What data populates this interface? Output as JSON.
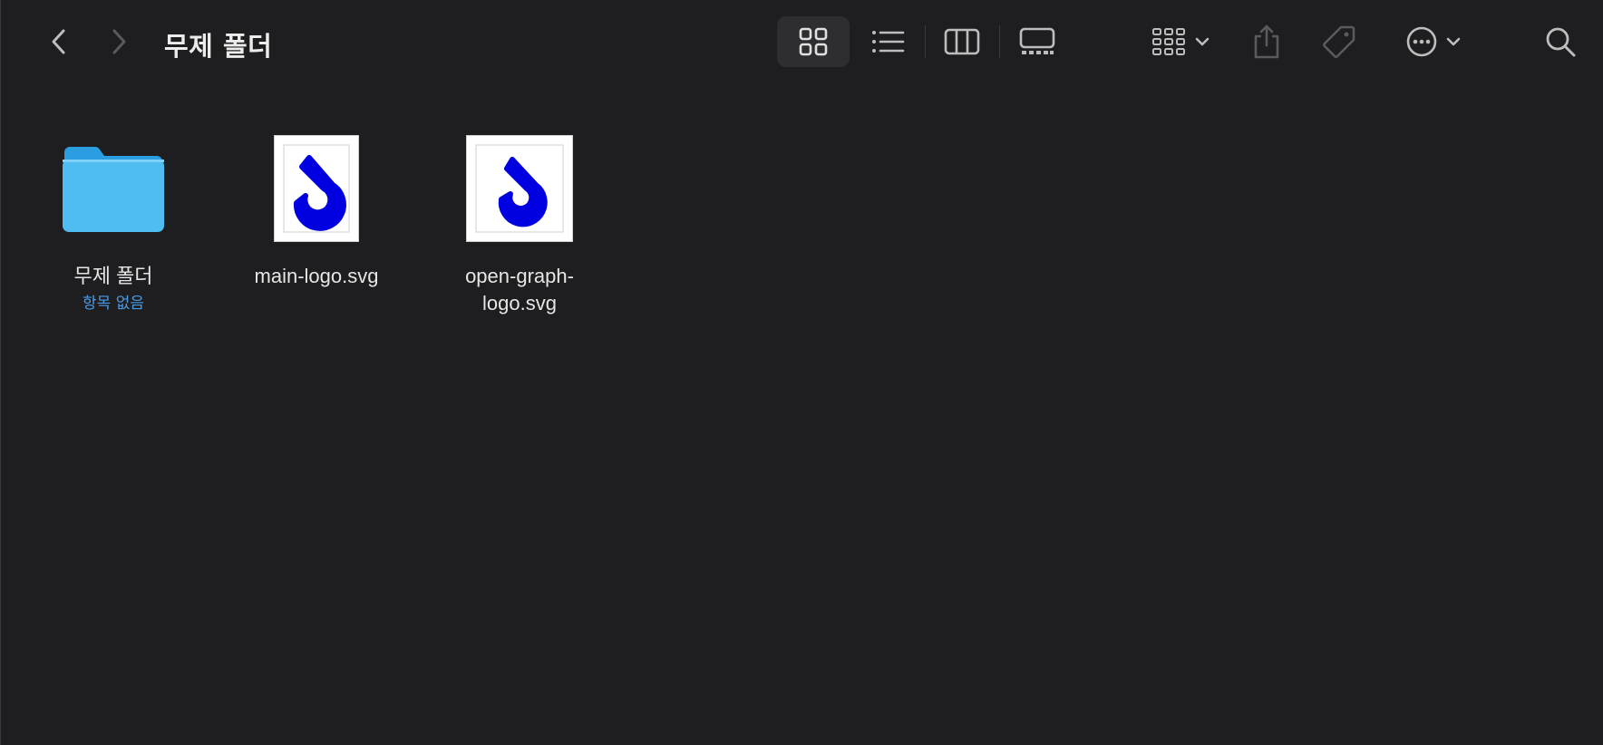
{
  "window": {
    "title": "무제 폴더"
  },
  "toolbar": {
    "back_icon": "chevron-left-icon",
    "forward_icon": "chevron-right-icon",
    "views": [
      {
        "icon": "grid-view-icon",
        "active": true
      },
      {
        "icon": "list-view-icon",
        "active": false
      },
      {
        "icon": "column-view-icon",
        "active": false
      },
      {
        "icon": "gallery-view-icon",
        "active": false
      }
    ],
    "group_icon": "group-by-icon",
    "share_icon": "share-icon",
    "tag_icon": "tag-icon",
    "more_icon": "more-icon",
    "search_icon": "search-icon"
  },
  "items": [
    {
      "name": "무제 폴더",
      "subtitle": "항목 없음",
      "kind": "folder"
    },
    {
      "name": "main-logo.svg",
      "kind": "svg"
    },
    {
      "name": "open-graph-logo.svg",
      "kind": "svg"
    }
  ],
  "colors": {
    "background": "#1e1e20",
    "folder": "#4fb7ef",
    "logo": "#0000e0",
    "subtitle": "#4a9ce8"
  }
}
